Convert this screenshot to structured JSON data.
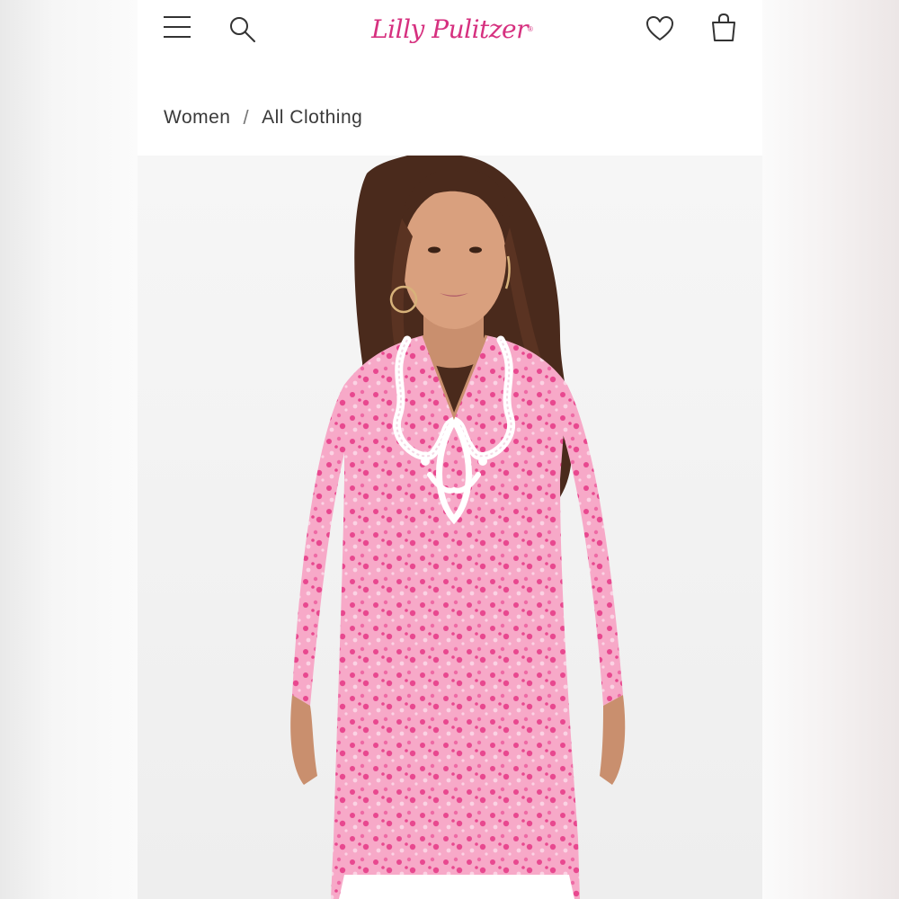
{
  "header": {
    "menu_icon": "hamburger-menu-icon",
    "search_icon": "search-icon",
    "logo_text": "Lilly Pulitzer",
    "logo_mark": "®",
    "wishlist_icon": "heart-icon",
    "bag_icon": "shopping-bag-icon"
  },
  "breadcrumb": {
    "items": [
      "Women",
      "All Clothing"
    ],
    "separator": "/"
  },
  "colors": {
    "brand": "#d6307f",
    "tunic_pink": "#f7a9c8",
    "tunic_print": "#e8488f",
    "text": "#3a3a3a"
  },
  "product_image": {
    "subject": "model-wearing-pink-printed-tunic-with-white-embroidered-neckline"
  }
}
